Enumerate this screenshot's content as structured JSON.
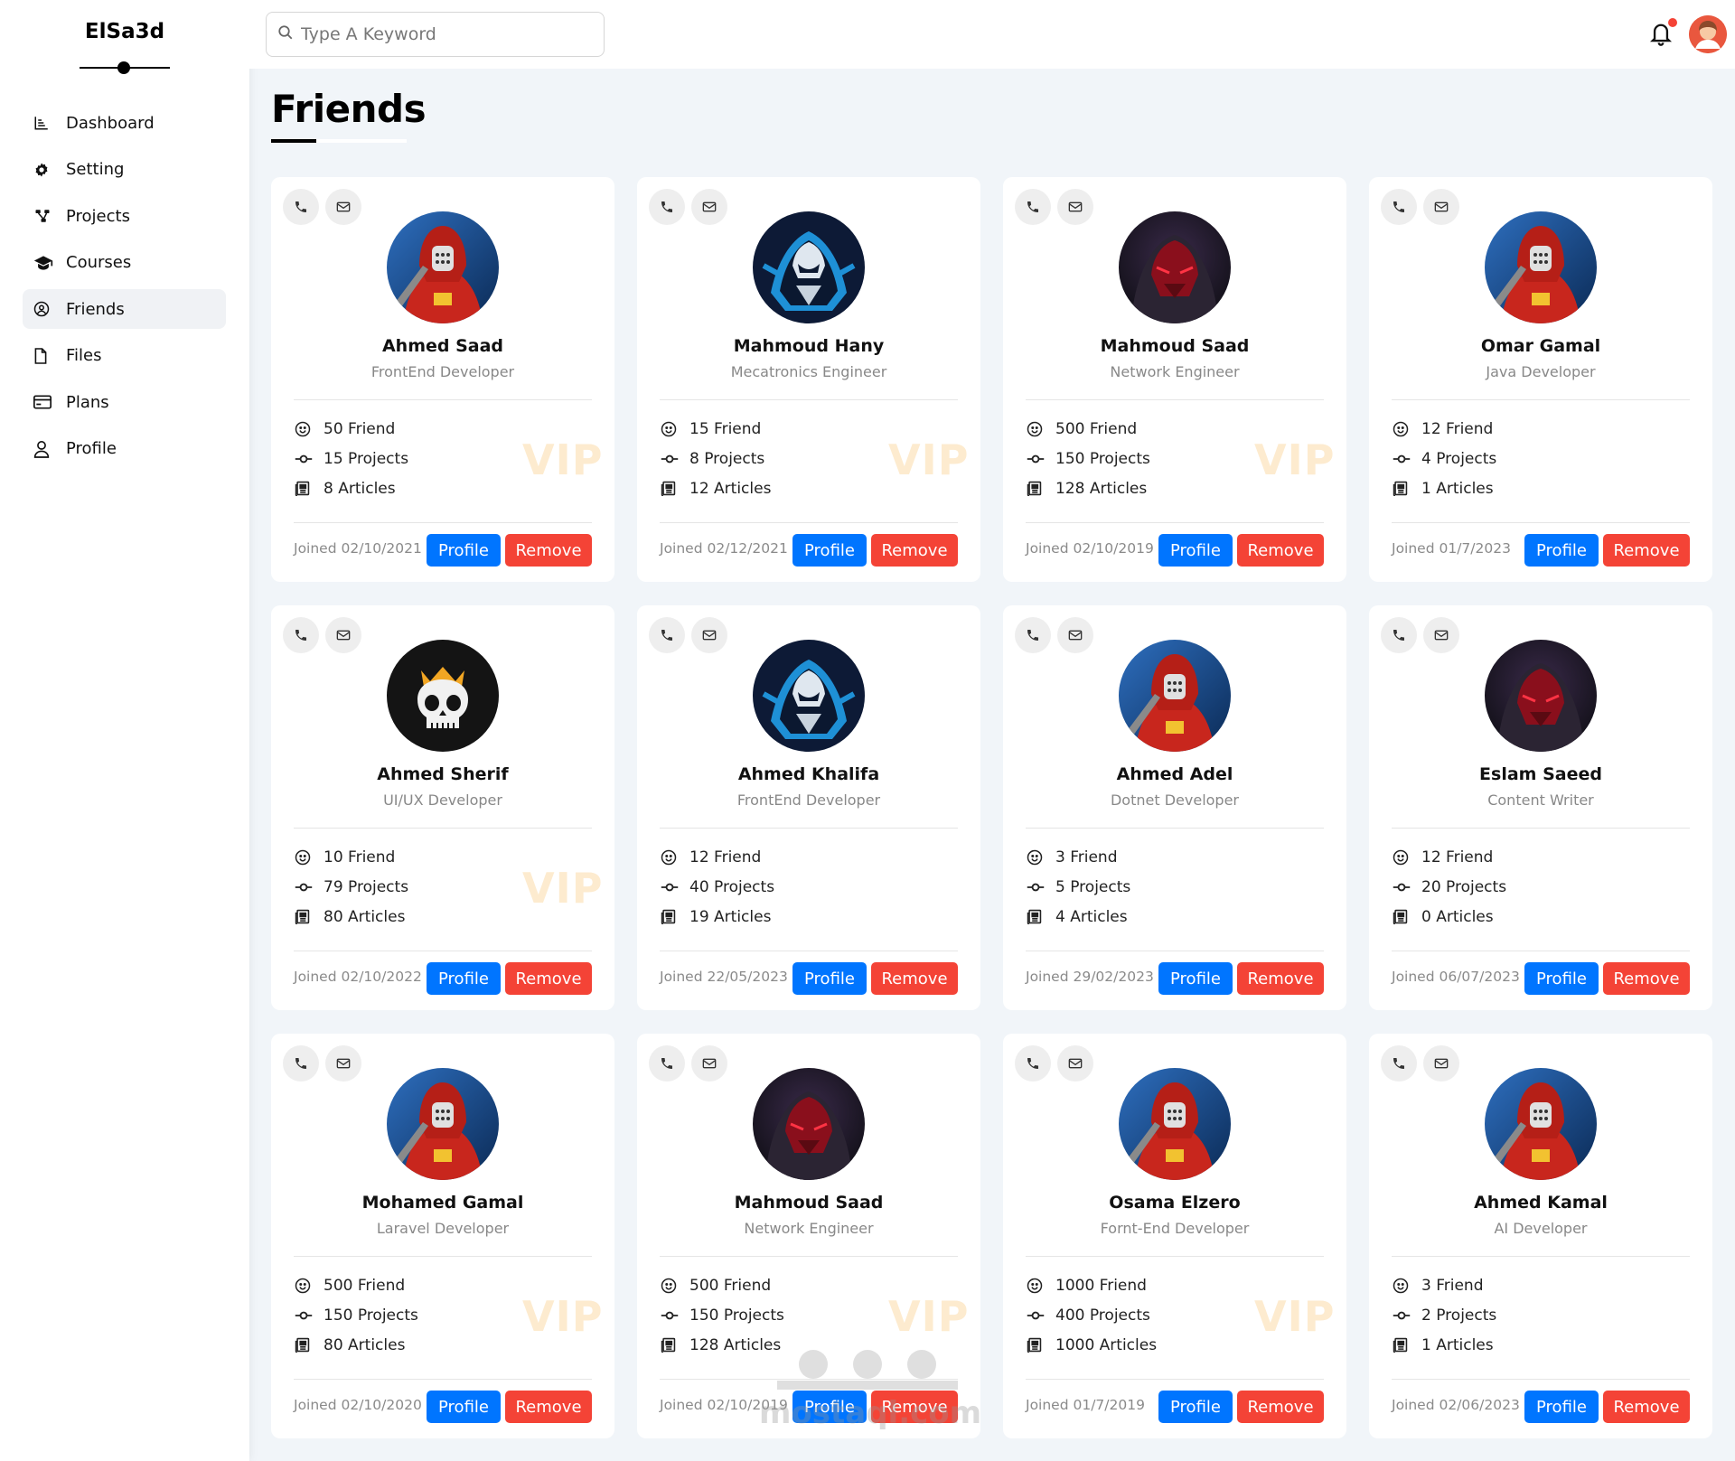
{
  "brand": "ElSa3d",
  "nav": [
    {
      "label": "Dashboard",
      "icon": "chart-icon"
    },
    {
      "label": "Setting",
      "icon": "gear-icon"
    },
    {
      "label": "Projects",
      "icon": "diagram-icon"
    },
    {
      "label": "Courses",
      "icon": "graduation-cap-icon"
    },
    {
      "label": "Friends",
      "icon": "user-circle-icon",
      "active": true
    },
    {
      "label": "Files",
      "icon": "file-icon"
    },
    {
      "label": "Plans",
      "icon": "credit-card-icon"
    },
    {
      "label": "Profile",
      "icon": "user-icon"
    }
  ],
  "search": {
    "placeholder": "Type A Keyword"
  },
  "page_title": "Friends",
  "colors": {
    "primary": "#0075ff",
    "danger": "#f44336",
    "background": "#f1f5f9",
    "vip": "#f5a523"
  },
  "friends": [
    {
      "name": "Ahmed Saad",
      "role": "FrontEnd Developer",
      "friends": "50 Friend",
      "projects": "15 Projects",
      "articles": "8 Articles",
      "vip": "VIP",
      "joined": "Joined 02/10/2021",
      "avatar": "red-hood"
    },
    {
      "name": "Mahmoud Hany",
      "role": "Mecatronics Engineer",
      "friends": "15 Friend",
      "projects": "8 Projects",
      "articles": "12 Articles",
      "vip": "VIP",
      "joined": "Joined 02/12/2021",
      "avatar": "blue-hood"
    },
    {
      "name": "Mahmoud Saad",
      "role": "Network Engineer",
      "friends": "500 Friend",
      "projects": "150 Projects",
      "articles": "128 Articles",
      "vip": "VIP",
      "joined": "Joined 02/10/2019",
      "avatar": "dark-mask"
    },
    {
      "name": "Omar Gamal",
      "role": "Java Developer",
      "friends": "12 Friend",
      "projects": "4 Projects",
      "articles": "1 Articles",
      "vip": "",
      "joined": "Joined 01/7/2023",
      "avatar": "red-hood"
    },
    {
      "name": "Ahmed Sherif",
      "role": "UI/UX Developer",
      "friends": "10 Friend",
      "projects": "79 Projects",
      "articles": "80 Articles",
      "vip": "VIP",
      "joined": "Joined 02/10/2022",
      "avatar": "skull"
    },
    {
      "name": "Ahmed Khalifa",
      "role": "FrontEnd Developer",
      "friends": "12 Friend",
      "projects": "40 Projects",
      "articles": "19 Articles",
      "vip": "",
      "joined": "Joined 22/05/2023",
      "avatar": "blue-hood"
    },
    {
      "name": "Ahmed Adel",
      "role": "Dotnet Developer",
      "friends": "3 Friend",
      "projects": "5 Projects",
      "articles": "4 Articles",
      "vip": "",
      "joined": "Joined 29/02/2023",
      "avatar": "red-hood"
    },
    {
      "name": "Eslam Saeed",
      "role": "Content Writer",
      "friends": "12 Friend",
      "projects": "20 Projects",
      "articles": "0 Articles",
      "vip": "",
      "joined": "Joined 06/07/2023",
      "avatar": "dark-mask"
    },
    {
      "name": "Mohamed Gamal",
      "role": "Laravel Developer",
      "friends": "500 Friend",
      "projects": "150 Projects",
      "articles": "80 Articles",
      "vip": "VIP",
      "joined": "Joined 02/10/2020",
      "avatar": "red-hood"
    },
    {
      "name": "Mahmoud Saad",
      "role": "Network Engineer",
      "friends": "500 Friend",
      "projects": "150 Projects",
      "articles": "128 Articles",
      "vip": "VIP",
      "joined": "Joined 02/10/2019",
      "avatar": "dark-mask"
    },
    {
      "name": "Osama Elzero",
      "role": "Fornt-End Developer",
      "friends": "1000 Friend",
      "projects": "400 Projects",
      "articles": "1000 Articles",
      "vip": "VIP",
      "joined": "Joined 01/7/2019",
      "avatar": "red-hood"
    },
    {
      "name": "Ahmed Kamal",
      "role": "AI Developer",
      "friends": "3 Friend",
      "projects": "2 Projects",
      "articles": "1 Articles",
      "vip": "",
      "joined": "Joined 02/06/2023",
      "avatar": "red-hood"
    }
  ],
  "buttons": {
    "profile": "Profile",
    "remove": "Remove"
  },
  "watermark": {
    "text": "mostaql.com"
  }
}
